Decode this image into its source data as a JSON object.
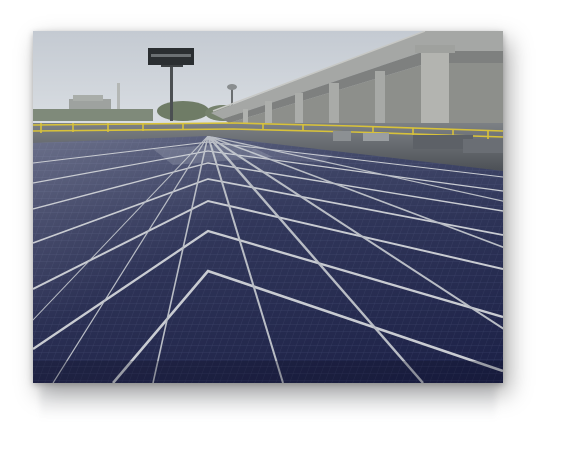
{
  "image": {
    "subject": "rooftop-solar-array",
    "elements": [
      "sky",
      "billboard",
      "highway-overpass",
      "safety-railing",
      "smokestack",
      "distant-buildings",
      "solar-panels"
    ],
    "colors": {
      "sky": "#d3d8de",
      "panel": "#20264a",
      "panel_frame": "#c9ccd2",
      "overpass": "#9a9c9c",
      "railing": "#d8c23a",
      "roof": "#6e7276"
    }
  }
}
